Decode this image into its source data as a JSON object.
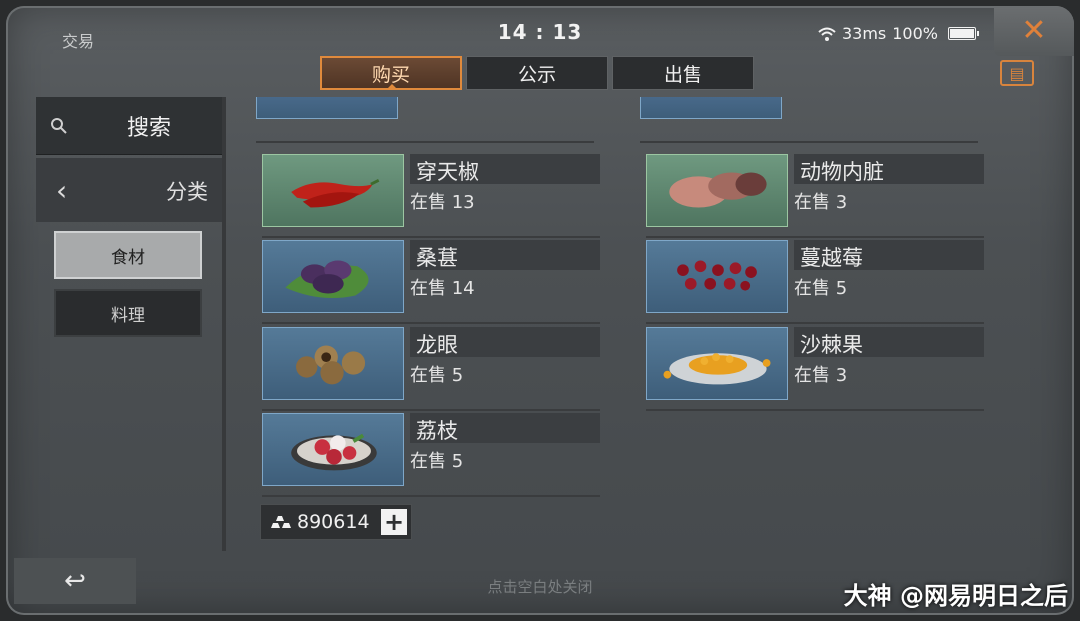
{
  "status": {
    "title": "交易",
    "clock": "14 : 13",
    "ping": "33ms",
    "battery_text": "100%",
    "battery_level": 1.0
  },
  "close_icon": "close-x-icon",
  "tabs": [
    {
      "label": "购买",
      "active": true
    },
    {
      "label": "公示",
      "active": false
    },
    {
      "label": "出售",
      "active": false
    }
  ],
  "sidebar": {
    "search_label": "搜索",
    "category_label": "分类",
    "sub": [
      "食材",
      "料理"
    ],
    "selected": "食材"
  },
  "items": [
    {
      "name": "穿天椒",
      "stock": "在售 13",
      "icon": "red-pepper-icon"
    },
    {
      "name": "动物内脏",
      "stock": "在售 3",
      "icon": "organ-meat-icon"
    },
    {
      "name": "桑葚",
      "stock": "在售 14",
      "icon": "mulberry-icon"
    },
    {
      "name": "蔓越莓",
      "stock": "在售 5",
      "icon": "cranberry-icon"
    },
    {
      "name": "龙眼",
      "stock": "在售 5",
      "icon": "longan-icon"
    },
    {
      "name": "沙棘果",
      "stock": "在售 3",
      "icon": "sea-buckthorn-icon"
    },
    {
      "name": "荔枝",
      "stock": "在售 5",
      "icon": "lychee-icon"
    }
  ],
  "currency": {
    "value": "890614",
    "icon": "gold-bars-icon"
  },
  "footer": {
    "hint": "点击空白处关闭",
    "back_icon": "return-arrow-icon",
    "watermark": "大神 @网易明日之后"
  },
  "colors": {
    "accent": "#e08a3c",
    "rare_green": "#6f9980",
    "common_blue": "#557a98"
  }
}
